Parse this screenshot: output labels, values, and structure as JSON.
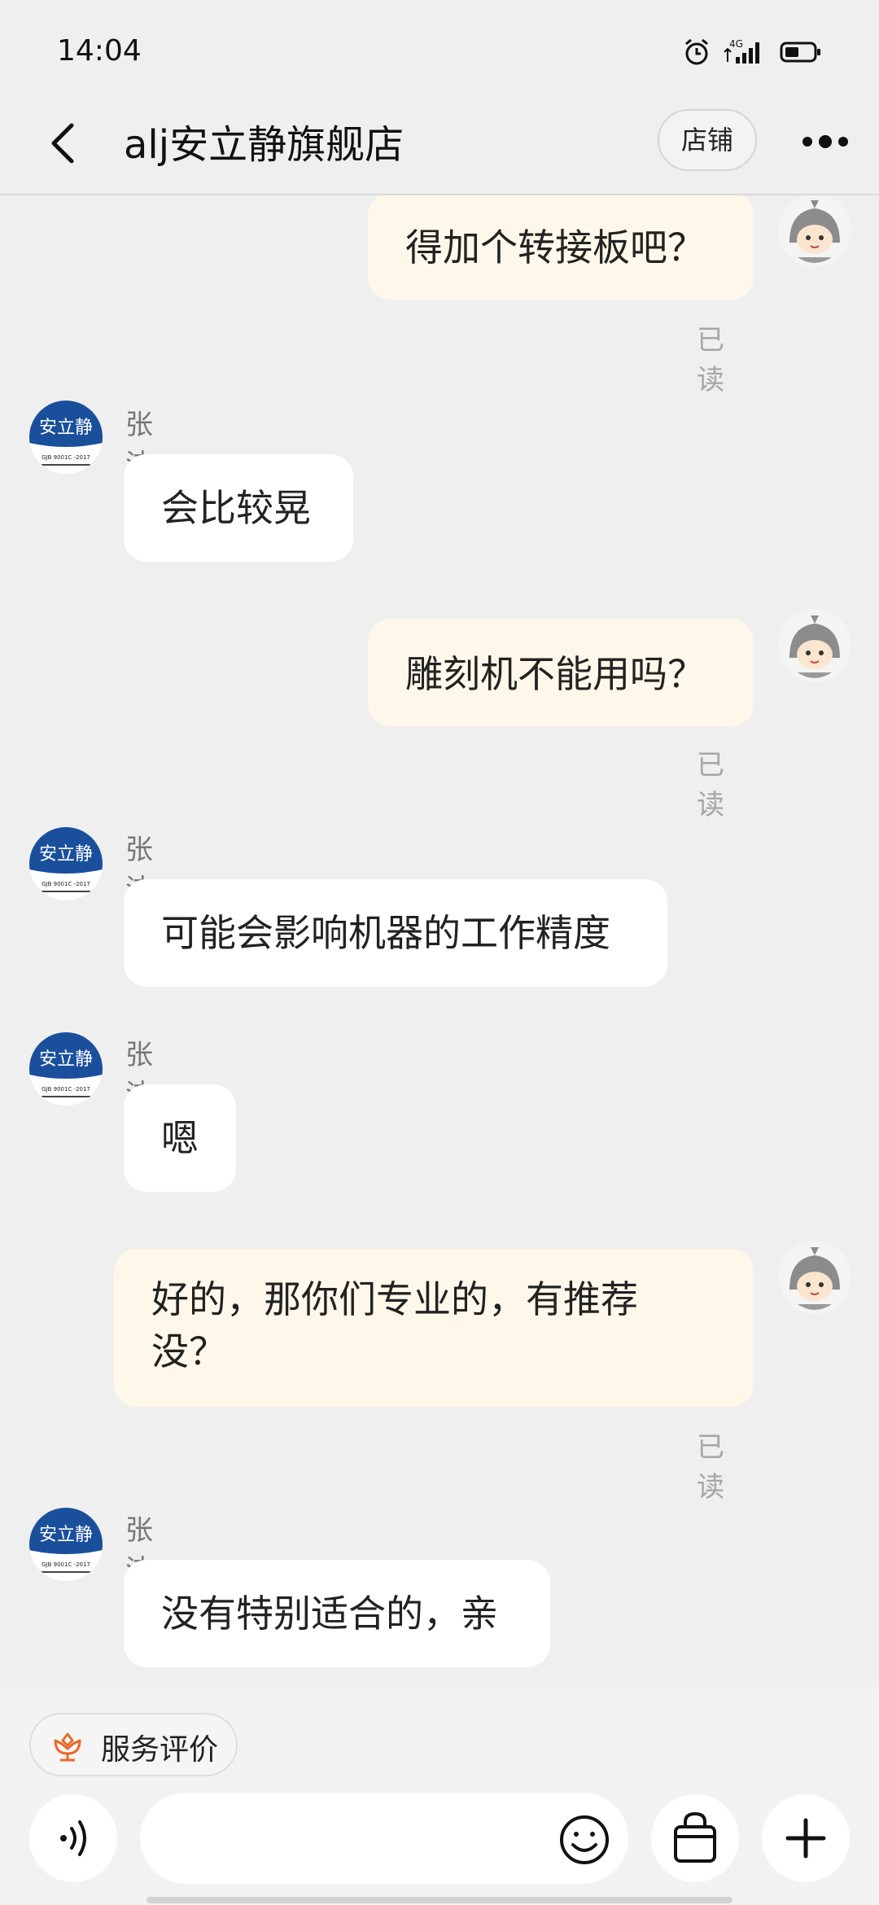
{
  "status": {
    "time": "14:04",
    "network": "4G"
  },
  "header": {
    "title": "alj安立静旗舰店",
    "shop_label": "店铺"
  },
  "avatars": {
    "store_logo_text": "安立静",
    "store_logo_subtext": "GJB 9001C -2017"
  },
  "messages": [
    {
      "side": "right",
      "text": "得加个转接板吧？",
      "status": "已读"
    },
    {
      "side": "left",
      "sender": "张洁",
      "text": "会比较晃"
    },
    {
      "side": "right",
      "text": "雕刻机不能用吗？",
      "status": "已读"
    },
    {
      "side": "left",
      "sender": "张洁",
      "text": "可能会影响机器的工作精度"
    },
    {
      "side": "left",
      "sender": "张洁",
      "text": "嗯"
    },
    {
      "side": "right",
      "text_line1": "好的，那你们专业的，有推荐",
      "text_line2": "没？",
      "status": "已读"
    },
    {
      "side": "left",
      "sender": "张洁",
      "text": "没有特别适合的，亲"
    }
  ],
  "bottom": {
    "rate_label": "服务评价",
    "input_placeholder": ""
  },
  "colors": {
    "right_bubble": "#fff8ea",
    "left_bubble": "#ffffff",
    "rate_icon": "#e86a2a",
    "logo_blue": "#1a4f9c"
  }
}
